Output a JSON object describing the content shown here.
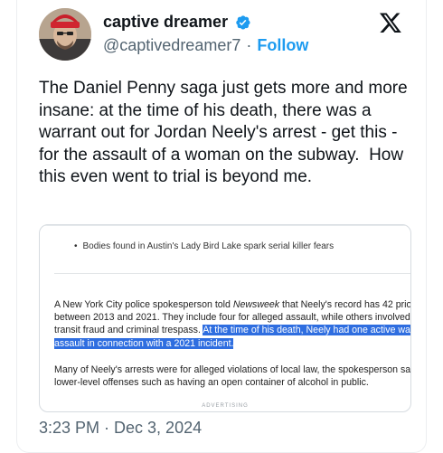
{
  "author": {
    "display_name": "captive dreamer",
    "handle": "@captivedreamer7",
    "separator": "·",
    "follow_label": "Follow"
  },
  "tweet": {
    "text": "The Daniel Penny saga just gets more and more insane: at the time of his death, there was a warrant out for Jordan Neely's arrest - get this - for the assault of a woman on the subway.  How this even went to trial is beyond me.",
    "timestamp": "3:23 PM · Dec 3, 2024"
  },
  "embed": {
    "bullet_text": "Bodies found in Austin's Lady Bird Lake spark serial killer fears",
    "paragraph1": {
      "line1_pre": "A New York City police spokesperson told ",
      "line1_em": "Newsweek",
      "line1_post": " that Neely's record has 42 prior arr",
      "line2": "between 2013 and 2021. They include four for alleged assault, while others involved acci",
      "line3_plain": "transit fraud and criminal trespass. ",
      "line3_hl": "At the time of his death, Neely had one active warran",
      "line4_hl": "assault in connection with a 2021 incident."
    },
    "paragraph2": {
      "line1": "Many of Neely's arrests were for alleged violations of local law, the spokesperson said, a",
      "line2": "lower-level offenses such as having an open container of alcohol in public."
    },
    "advert_label": "ADVERTISING"
  },
  "colors": {
    "link_blue": "#1d9bf0",
    "highlight": "#2f6ee0",
    "secondary_text": "#536471"
  },
  "icons": {
    "verified": "verified-badge-icon",
    "x_logo": "x-logo-icon"
  }
}
